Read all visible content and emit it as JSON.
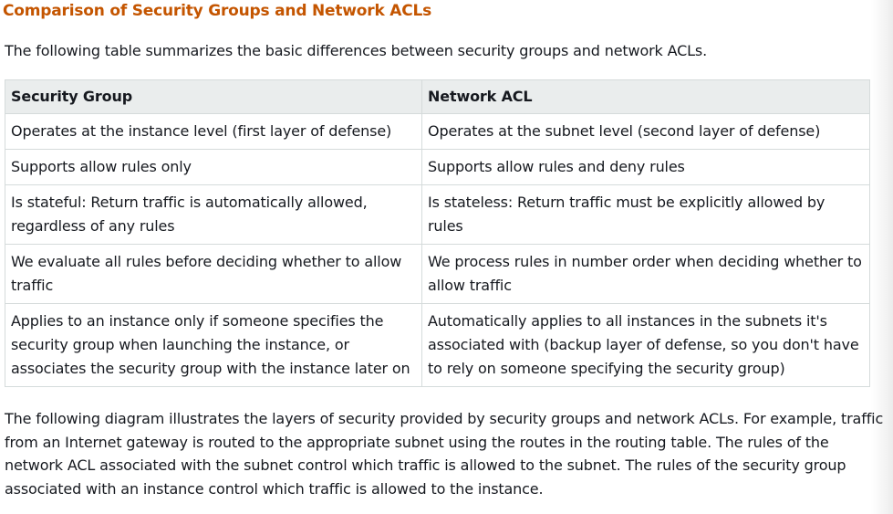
{
  "heading": "Comparison of Security Groups and Network ACLs",
  "intro": "The following table summarizes the basic differences between security groups and network ACLs.",
  "table": {
    "headers": [
      "Security Group",
      "Network ACL"
    ],
    "rows": [
      [
        "Operates at the instance level (first layer of defense)",
        "Operates at the subnet level (second layer of defense)"
      ],
      [
        "Supports allow rules only",
        "Supports allow rules and deny rules"
      ],
      [
        "Is stateful: Return traffic is automatically allowed, regardless of any rules",
        "Is stateless: Return traffic must be explicitly allowed by rules"
      ],
      [
        "We evaluate all rules before deciding whether to allow traffic",
        "We process rules in number order when deciding whether to allow traffic"
      ],
      [
        "Applies to an instance only if someone specifies the security group when launching the instance, or associates the security group with the instance later on",
        "Automatically applies to all instances in the subnets it's associated with (backup layer of defense, so you don't have to rely on someone specifying the security group)"
      ]
    ]
  },
  "outro": "The following diagram illustrates the layers of security provided by security groups and network ACLs. For example, traffic from an Internet gateway is routed to the appropriate subnet using the routes in the routing table. The rules of the network ACL associated with the subnet control which traffic is allowed to the subnet. The rules of the security group associated with an instance control which traffic is allowed to the instance."
}
